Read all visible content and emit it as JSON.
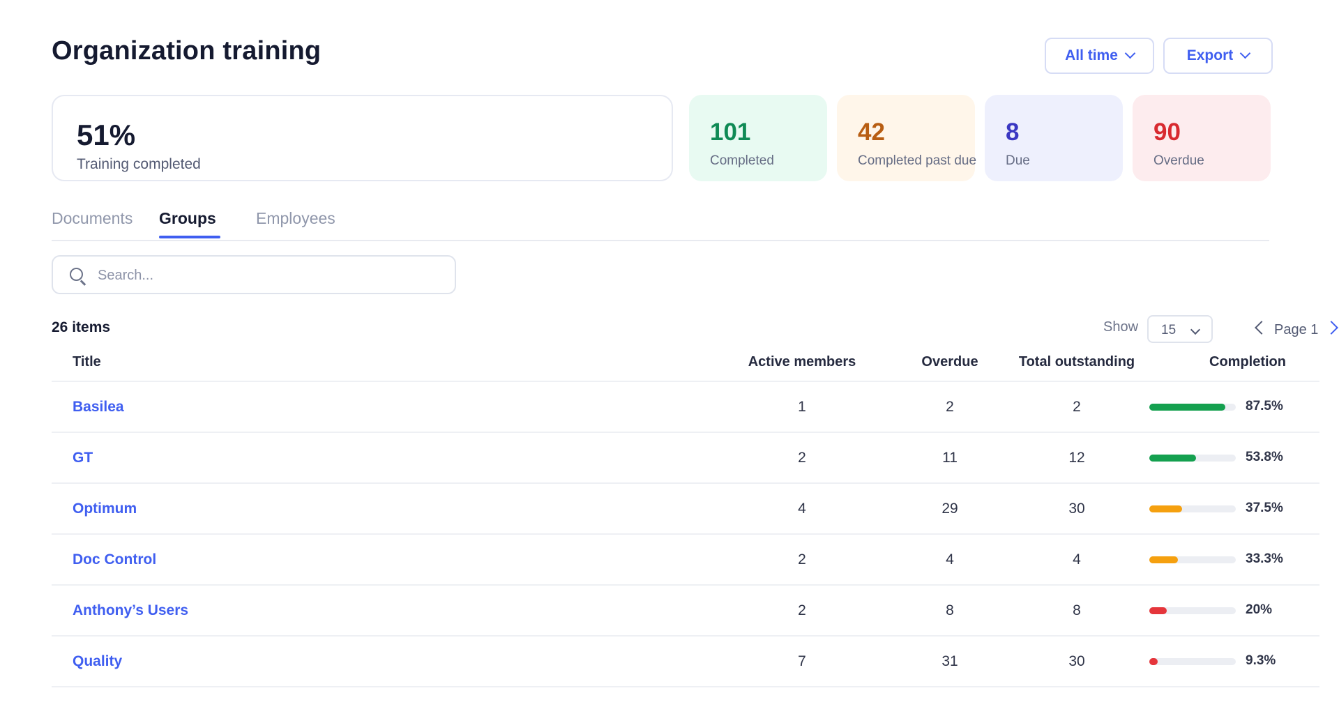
{
  "header": {
    "title": "Organization training",
    "range_label": "All time",
    "export_label": "Export"
  },
  "summary": {
    "percent": "51%",
    "label": "Training completed"
  },
  "stats": {
    "completed": {
      "value": "101",
      "label": "Completed"
    },
    "past_due": {
      "value": "42",
      "label": "Completed past due"
    },
    "due": {
      "value": "8",
      "label": "Due"
    },
    "overdue": {
      "value": "90",
      "label": "Overdue"
    }
  },
  "tabs": [
    {
      "label": "Documents"
    },
    {
      "label": "Groups"
    },
    {
      "label": "Employees"
    }
  ],
  "active_tab": "Groups",
  "search": {
    "placeholder": "Search...",
    "value": ""
  },
  "list": {
    "items_count": "26 items",
    "show_label": "Show",
    "show_value": "15",
    "page_label": "Page 1"
  },
  "table": {
    "columns": {
      "title": "Title",
      "active_members": "Active members",
      "overdue": "Overdue",
      "total_outstanding": "Total outstanding",
      "completion": "Completion"
    },
    "rows": [
      {
        "title": "Basilea",
        "active_members": "1",
        "overdue": "2",
        "total_outstanding": "2",
        "completion": "87.5%",
        "completion_value": 87.5,
        "status_color": "#14a04f"
      },
      {
        "title": "GT",
        "active_members": "2",
        "overdue": "11",
        "total_outstanding": "12",
        "completion": "53.8%",
        "completion_value": 53.8,
        "status_color": "#14a04f"
      },
      {
        "title": "Optimum",
        "active_members": "4",
        "overdue": "29",
        "total_outstanding": "30",
        "completion": "37.5%",
        "completion_value": 37.5,
        "status_color": "#f5a00f"
      },
      {
        "title": "Doc Control",
        "active_members": "2",
        "overdue": "4",
        "total_outstanding": "4",
        "completion": "33.3%",
        "completion_value": 33.3,
        "status_color": "#f5a00f"
      },
      {
        "title": "Anthony’s Users",
        "active_members": "2",
        "overdue": "8",
        "total_outstanding": "8",
        "completion": "20%",
        "completion_value": 20,
        "status_color": "#e5353b"
      },
      {
        "title": "Quality",
        "active_members": "7",
        "overdue": "31",
        "total_outstanding": "30",
        "completion": "9.3%",
        "completion_value": 9.3,
        "status_color": "#e5353b"
      }
    ]
  },
  "colors": {
    "accent": "#3f5ef0",
    "completed": "#0f8a55",
    "past_due": "#b85e13",
    "due": "#3a37c2",
    "overdue": "#d82a30"
  }
}
